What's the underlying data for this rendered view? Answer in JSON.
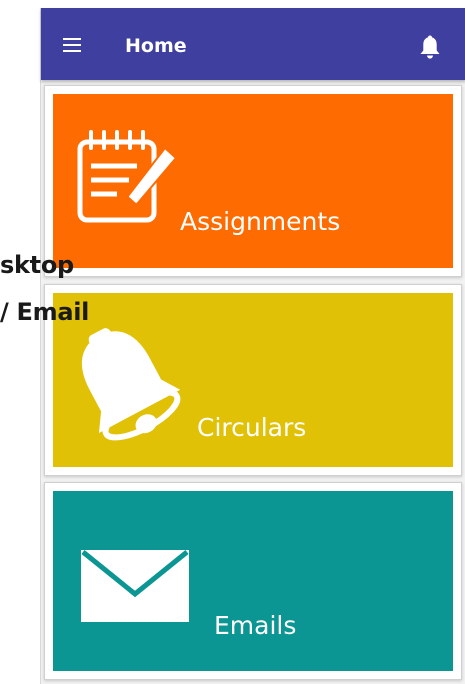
{
  "background_overlay": {
    "line_1": "sktop",
    "line_2": "/ Email"
  },
  "header": {
    "menu_icon": "hamburger-menu-icon",
    "title": "Home",
    "bell_icon": "bell-icon",
    "background_color": "#3f3f9f"
  },
  "tiles": [
    {
      "label": "Assignments",
      "icon": "notepad-pencil-icon",
      "color": "#fd6b01"
    },
    {
      "label": "Circulars",
      "icon": "bell-icon",
      "color": "#e1c105"
    },
    {
      "label": "Emails",
      "icon": "envelope-icon",
      "color": "#0b9693"
    }
  ]
}
